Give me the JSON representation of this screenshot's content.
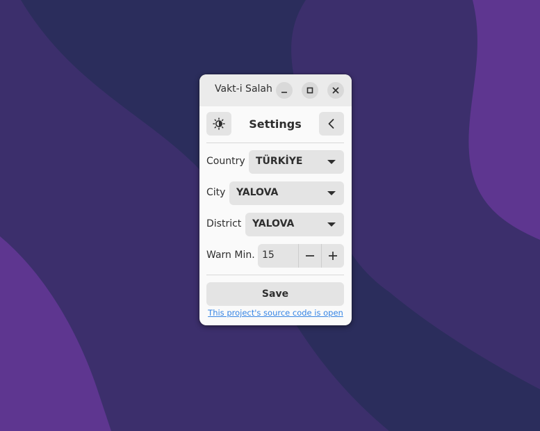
{
  "window": {
    "title": "Vakt-i Salah"
  },
  "header": {
    "title": "Settings",
    "theme_icon": "theme-toggle-icon",
    "back_icon": "chevron-left-icon"
  },
  "form": {
    "country_label": "Country",
    "country_value": "TÜRKİYE",
    "city_label": "City",
    "city_value": "YALOVA",
    "district_label": "District",
    "district_value": "YALOVA",
    "warn_label": "Warn Min.",
    "warn_value": "15"
  },
  "actions": {
    "save_label": "Save",
    "source_link": "This project's source code is open"
  },
  "colors": {
    "link": "#3584e4",
    "window_bg": "#fafafa",
    "titlebar_bg": "#ebebeb",
    "wallpaper_dark": "#2c2f5e",
    "wallpaper_mid": "#3d306e",
    "wallpaper_light": "#5f3590"
  }
}
